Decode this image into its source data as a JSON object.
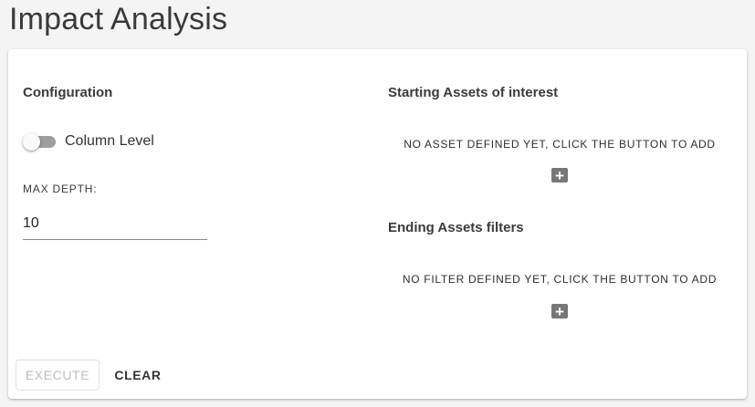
{
  "page": {
    "title": "Impact Analysis"
  },
  "configuration": {
    "title": "Configuration",
    "column_level": {
      "label": "Column Level",
      "checked": false
    },
    "max_depth": {
      "label": "MAX DEPTH:",
      "value": "10"
    }
  },
  "starting_assets": {
    "title": "Starting Assets of interest",
    "empty_message": "NO ASSET DEFINED YET, CLICK THE BUTTON TO ADD",
    "add_icon": "plus-icon"
  },
  "ending_assets": {
    "title": "Ending Assets filters",
    "empty_message": "NO FILTER DEFINED YET, CLICK THE BUTTON TO ADD",
    "add_icon": "plus-icon"
  },
  "actions": {
    "execute_label": "EXECUTE",
    "execute_disabled": true,
    "clear_label": "CLEAR"
  },
  "colors": {
    "background": "#f4f4f4",
    "card": "#ffffff",
    "switch_track_off": "#9e9e9e",
    "add_button": "#777777",
    "disabled_text": "#bdbdbd"
  }
}
